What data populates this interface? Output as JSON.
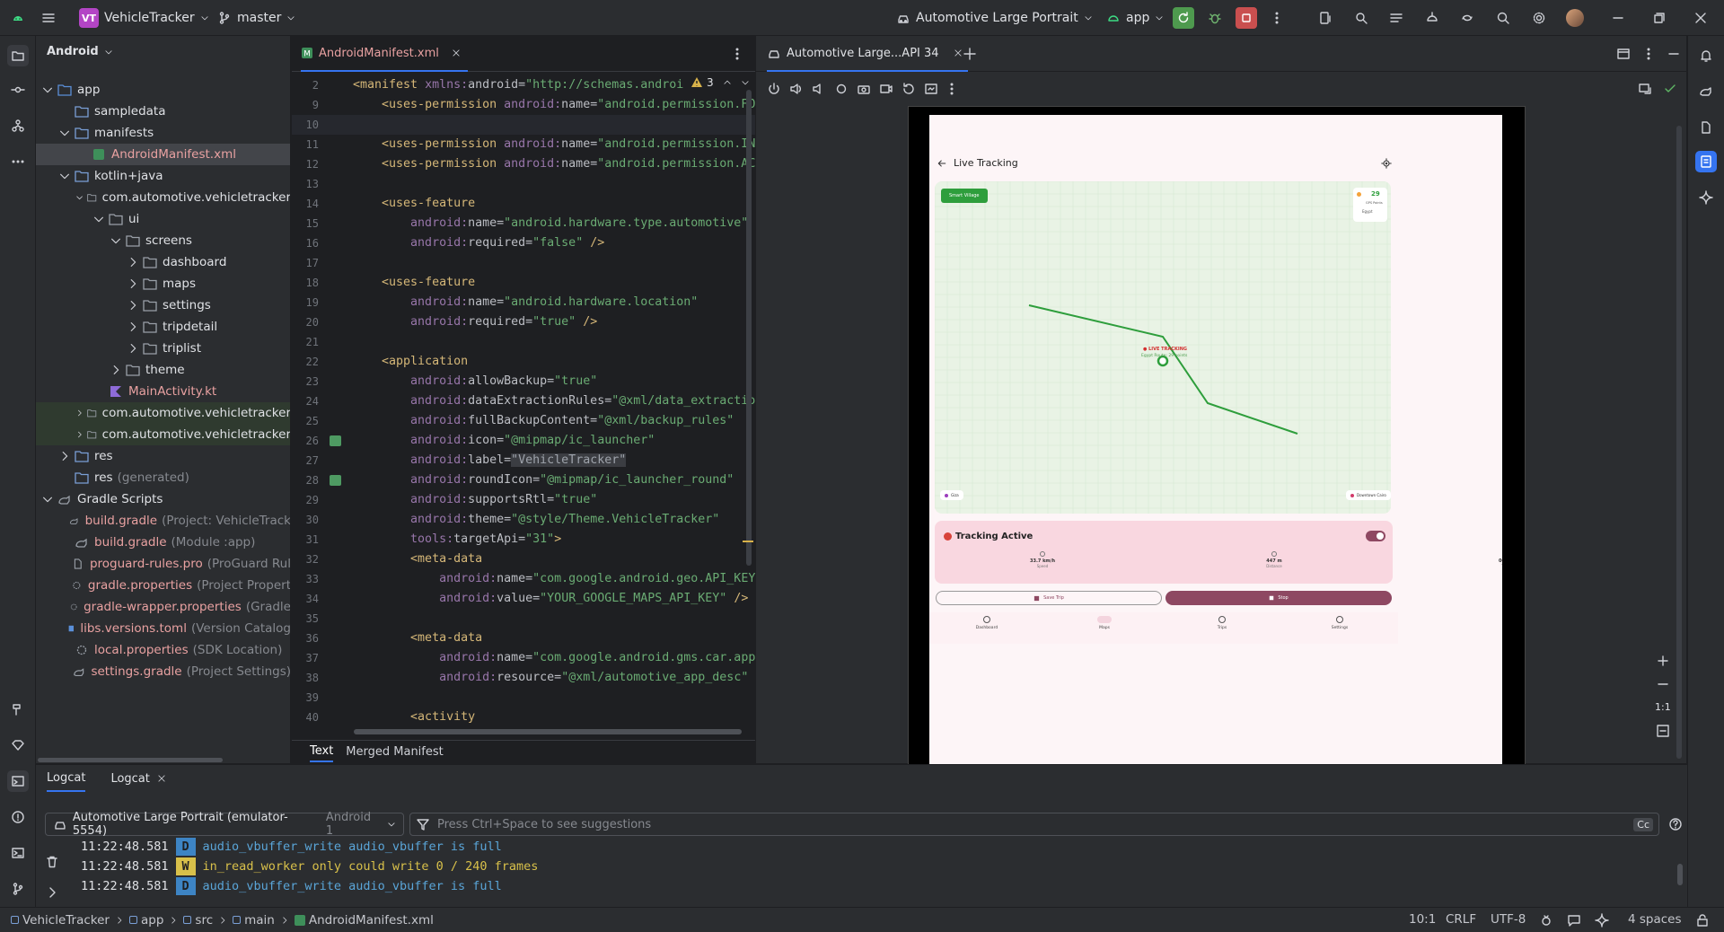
{
  "titlebar": {
    "project_badge": "VT",
    "project_name": "VehicleTracker",
    "branch": "master",
    "run_config": "Automotive Large Portrait",
    "module": "app"
  },
  "project_panel": {
    "view_mode": "Android",
    "tree": [
      {
        "label": "app",
        "depth": 0,
        "kind": "module",
        "expanded": true
      },
      {
        "label": "sampledata",
        "depth": 1,
        "kind": "folder"
      },
      {
        "label": "manifests",
        "depth": 1,
        "kind": "folder",
        "expanded": true
      },
      {
        "label": "AndroidManifest.xml",
        "depth": 2,
        "kind": "manifest",
        "selected": true
      },
      {
        "label": "kotlin+java",
        "depth": 1,
        "kind": "folder",
        "expanded": true
      },
      {
        "label": "com.automotive.vehicletracker",
        "depth": 2,
        "kind": "package",
        "expanded": true
      },
      {
        "label": "ui",
        "depth": 3,
        "kind": "package",
        "expanded": true
      },
      {
        "label": "screens",
        "depth": 4,
        "kind": "package",
        "expanded": true
      },
      {
        "label": "dashboard",
        "depth": 5,
        "kind": "package",
        "collapsed": true
      },
      {
        "label": "maps",
        "depth": 5,
        "kind": "package",
        "collapsed": true
      },
      {
        "label": "settings",
        "depth": 5,
        "kind": "package",
        "collapsed": true
      },
      {
        "label": "tripdetail",
        "depth": 5,
        "kind": "package",
        "collapsed": true
      },
      {
        "label": "triplist",
        "depth": 5,
        "kind": "package",
        "collapsed": true
      },
      {
        "label": "theme",
        "depth": 4,
        "kind": "package",
        "collapsed": true
      },
      {
        "label": "MainActivity.kt",
        "depth": 3,
        "kind": "kotlin"
      },
      {
        "label": "com.automotive.vehicletracker",
        "suffix": "",
        "depth": 2,
        "kind": "package",
        "collapsed": true,
        "highlight": true
      },
      {
        "label": "com.automotive.vehicletracker",
        "suffix": "",
        "depth": 2,
        "kind": "package",
        "collapsed": true,
        "highlight": true
      },
      {
        "label": "res",
        "depth": 1,
        "kind": "folder",
        "collapsed": true
      },
      {
        "label": "res",
        "suffix": "(generated)",
        "depth": 1,
        "kind": "folder"
      },
      {
        "label": "Gradle Scripts",
        "depth": 0,
        "kind": "gradle-root",
        "expanded": true
      },
      {
        "label": "build.gradle",
        "suffix": "(Project: VehicleTrack",
        "depth": 1,
        "kind": "gradle"
      },
      {
        "label": "build.gradle",
        "suffix": "(Module :app)",
        "depth": 1,
        "kind": "gradle"
      },
      {
        "label": "proguard-rules.pro",
        "suffix": "(ProGuard Rul",
        "depth": 1,
        "kind": "file"
      },
      {
        "label": "gradle.properties",
        "suffix": "(Project Propert",
        "depth": 1,
        "kind": "settings"
      },
      {
        "label": "gradle-wrapper.properties",
        "suffix": "(Gradle",
        "depth": 1,
        "kind": "settings"
      },
      {
        "label": "libs.versions.toml",
        "suffix": "(Version Catalog",
        "depth": 1,
        "kind": "toml"
      },
      {
        "label": "local.properties",
        "suffix": "(SDK Location)",
        "depth": 1,
        "kind": "settings"
      },
      {
        "label": "settings.gradle",
        "suffix": "(Project Settings)",
        "depth": 1,
        "kind": "gradle"
      }
    ]
  },
  "editor": {
    "tab": "AndroidManifest.xml",
    "warning_count": "3",
    "bottom_tabs": [
      "Text",
      "Merged Manifest"
    ],
    "lines": [
      {
        "n": "2",
        "segs": [
          [
            "t-tag",
            "<manifest "
          ],
          [
            "t-ns",
            "xmlns:"
          ],
          [
            "t-attr",
            "android="
          ],
          [
            "t-str",
            "\"http://schemas.androi"
          ]
        ]
      },
      {
        "n": "9",
        "segs": [
          [
            "t-plain",
            "    "
          ],
          [
            "t-tag",
            "<uses-permission "
          ],
          [
            "t-ns",
            "android:"
          ],
          [
            "t-attr",
            "name="
          ],
          [
            "t-str",
            "\"android.permission.FO"
          ]
        ]
      },
      {
        "n": "10",
        "segs": []
      },
      {
        "n": "11",
        "segs": [
          [
            "t-plain",
            "    "
          ],
          [
            "t-tag",
            "<uses-permission "
          ],
          [
            "t-ns",
            "android:"
          ],
          [
            "t-attr",
            "name="
          ],
          [
            "t-str",
            "\"android.permission.IN"
          ]
        ]
      },
      {
        "n": "12",
        "segs": [
          [
            "t-plain",
            "    "
          ],
          [
            "t-tag",
            "<uses-permission "
          ],
          [
            "t-ns",
            "android:"
          ],
          [
            "t-attr",
            "name="
          ],
          [
            "t-str",
            "\"android.permission.AC"
          ]
        ]
      },
      {
        "n": "13",
        "segs": []
      },
      {
        "n": "14",
        "segs": [
          [
            "t-plain",
            "    "
          ],
          [
            "t-tag",
            "<uses-feature"
          ]
        ]
      },
      {
        "n": "15",
        "segs": [
          [
            "t-plain",
            "        "
          ],
          [
            "t-ns",
            "android:"
          ],
          [
            "t-attr",
            "name="
          ],
          [
            "t-str",
            "\"android.hardware.type.automotive\""
          ]
        ]
      },
      {
        "n": "16",
        "segs": [
          [
            "t-plain",
            "        "
          ],
          [
            "t-ns",
            "android:"
          ],
          [
            "t-attr",
            "required="
          ],
          [
            "t-str",
            "\"false\""
          ],
          [
            "t-tag",
            " />"
          ]
        ]
      },
      {
        "n": "17",
        "segs": []
      },
      {
        "n": "18",
        "segs": [
          [
            "t-plain",
            "    "
          ],
          [
            "t-tag",
            "<uses-feature"
          ]
        ]
      },
      {
        "n": "19",
        "segs": [
          [
            "t-plain",
            "        "
          ],
          [
            "t-ns",
            "android:"
          ],
          [
            "t-attr",
            "name="
          ],
          [
            "t-str",
            "\"android.hardware.location\""
          ]
        ]
      },
      {
        "n": "20",
        "segs": [
          [
            "t-plain",
            "        "
          ],
          [
            "t-ns",
            "android:"
          ],
          [
            "t-attr",
            "required="
          ],
          [
            "t-str",
            "\"true\""
          ],
          [
            "t-tag",
            " />"
          ]
        ]
      },
      {
        "n": "21",
        "segs": []
      },
      {
        "n": "22",
        "segs": [
          [
            "t-plain",
            "    "
          ],
          [
            "t-tag",
            "<application"
          ]
        ]
      },
      {
        "n": "23",
        "segs": [
          [
            "t-plain",
            "        "
          ],
          [
            "t-ns",
            "android:"
          ],
          [
            "t-attr",
            "allowBackup="
          ],
          [
            "t-str",
            "\"true\""
          ]
        ]
      },
      {
        "n": "24",
        "segs": [
          [
            "t-plain",
            "        "
          ],
          [
            "t-ns",
            "android:"
          ],
          [
            "t-attr",
            "dataExtractionRules="
          ],
          [
            "t-str",
            "\"@xml/data_extractio"
          ]
        ]
      },
      {
        "n": "25",
        "segs": [
          [
            "t-plain",
            "        "
          ],
          [
            "t-ns",
            "android:"
          ],
          [
            "t-attr",
            "fullBackupContent="
          ],
          [
            "t-str",
            "\"@xml/backup_rules\""
          ]
        ]
      },
      {
        "n": "26",
        "segs": [
          [
            "t-plain",
            "        "
          ],
          [
            "t-ns",
            "android:"
          ],
          [
            "t-attr",
            "icon="
          ],
          [
            "t-str",
            "\"@mipmap/ic_launcher\""
          ]
        ]
      },
      {
        "n": "27",
        "segs": [
          [
            "t-plain",
            "        "
          ],
          [
            "t-ns",
            "android:"
          ],
          [
            "t-attr",
            "label="
          ],
          [
            "t-plain",
            "\"VehicleTracker\""
          ]
        ]
      },
      {
        "n": "28",
        "segs": [
          [
            "t-plain",
            "        "
          ],
          [
            "t-ns",
            "android:"
          ],
          [
            "t-attr",
            "roundIcon="
          ],
          [
            "t-str",
            "\"@mipmap/ic_launcher_round\""
          ]
        ]
      },
      {
        "n": "29",
        "segs": [
          [
            "t-plain",
            "        "
          ],
          [
            "t-ns",
            "android:"
          ],
          [
            "t-attr",
            "supportsRtl="
          ],
          [
            "t-str",
            "\"true\""
          ]
        ]
      },
      {
        "n": "30",
        "segs": [
          [
            "t-plain",
            "        "
          ],
          [
            "t-ns",
            "android:"
          ],
          [
            "t-attr",
            "theme="
          ],
          [
            "t-str",
            "\"@style/Theme.VehicleTracker\""
          ]
        ]
      },
      {
        "n": "31",
        "segs": [
          [
            "t-plain",
            "        "
          ],
          [
            "t-ns",
            "tools:"
          ],
          [
            "t-attr",
            "targetApi="
          ],
          [
            "t-str",
            "\"31\""
          ],
          [
            "t-tag",
            ">"
          ]
        ]
      },
      {
        "n": "32",
        "segs": [
          [
            "t-plain",
            "        "
          ],
          [
            "t-tag",
            "<meta-data"
          ]
        ]
      },
      {
        "n": "33",
        "segs": [
          [
            "t-plain",
            "            "
          ],
          [
            "t-ns",
            "android:"
          ],
          [
            "t-attr",
            "name="
          ],
          [
            "t-str",
            "\"com.google.android.geo.API_KEY"
          ]
        ]
      },
      {
        "n": "34",
        "segs": [
          [
            "t-plain",
            "            "
          ],
          [
            "t-ns",
            "android:"
          ],
          [
            "t-attr",
            "value="
          ],
          [
            "t-str",
            "\"YOUR_GOOGLE_MAPS_API_KEY\""
          ],
          [
            "t-tag",
            " />"
          ]
        ]
      },
      {
        "n": "35",
        "segs": []
      },
      {
        "n": "36",
        "segs": [
          [
            "t-plain",
            "        "
          ],
          [
            "t-tag",
            "<meta-data"
          ]
        ]
      },
      {
        "n": "37",
        "segs": [
          [
            "t-plain",
            "            "
          ],
          [
            "t-ns",
            "android:"
          ],
          [
            "t-attr",
            "name="
          ],
          [
            "t-str",
            "\"com.google.android.gms.car.app"
          ]
        ]
      },
      {
        "n": "38",
        "segs": [
          [
            "t-plain",
            "            "
          ],
          [
            "t-ns",
            "android:"
          ],
          [
            "t-attr",
            "resource="
          ],
          [
            "t-str",
            "\"@xml/automotive_app_desc\""
          ]
        ]
      },
      {
        "n": "39",
        "segs": []
      },
      {
        "n": "40",
        "segs": [
          [
            "t-plain",
            "        "
          ],
          [
            "t-tag",
            "<activity"
          ]
        ]
      }
    ]
  },
  "emulator": {
    "tab": "Automotive Large...API 34",
    "zoom_label": "1:1",
    "app": {
      "screen_title": "Live Tracking",
      "map_chip": "Smart Village",
      "gps_count": "29",
      "gps_label": "GPS Points",
      "gps_region": "Egypt",
      "tracking_label": "LIVE TRACKING",
      "tracking_sub": "Egypt Route: 29 points",
      "start_label": "Giza",
      "end_label": "Downtown Cairo",
      "card_title": "Tracking Active",
      "stats": [
        {
          "value": "33.7 km/h",
          "label": "Speed"
        },
        {
          "value": "447 m",
          "label": "Distance"
        },
        {
          "value": "00:58",
          "label": "Time"
        }
      ],
      "save_btn": "Save Trip",
      "stop_btn": "Stop",
      "nav": [
        {
          "label": "Dashboard",
          "active": false
        },
        {
          "label": "Maps",
          "active": true
        },
        {
          "label": "Trips",
          "active": false
        },
        {
          "label": "Settings",
          "active": false
        }
      ],
      "colors": {
        "accent": "#2e9e3c",
        "track_bg": "#e9f3e5",
        "card_bg": "#f9d7e0",
        "stop": "#8e4862"
      }
    }
  },
  "logcat": {
    "tabs": [
      "Logcat",
      "Logcat"
    ],
    "device": "Automotive Large Portrait (emulator-5554)",
    "device_api": "Android 1",
    "filter_placeholder": "Press Ctrl+Space to see suggestions",
    "cc": "Cc",
    "lines": [
      {
        "time": "11:22:48.581",
        "level": "D",
        "msg": "audio_vbuffer_write audio_vbuffer is full"
      },
      {
        "time": "11:22:48.581",
        "level": "W",
        "msg": "in_read_worker only could write 0 / 240 frames"
      },
      {
        "time": "11:22:48.581",
        "level": "D",
        "msg": "audio_vbuffer_write audio_vbuffer is full"
      }
    ],
    "colors": {
      "D": "#3d84c4",
      "W": "#d8c04a"
    }
  },
  "statusbar": {
    "breadcrumb": [
      "VehicleTracker",
      "app",
      "src",
      "main",
      "AndroidManifest.xml"
    ],
    "position": "10:1",
    "line_sep": "CRLF",
    "encoding": "UTF-8",
    "indent": "4 spaces"
  }
}
